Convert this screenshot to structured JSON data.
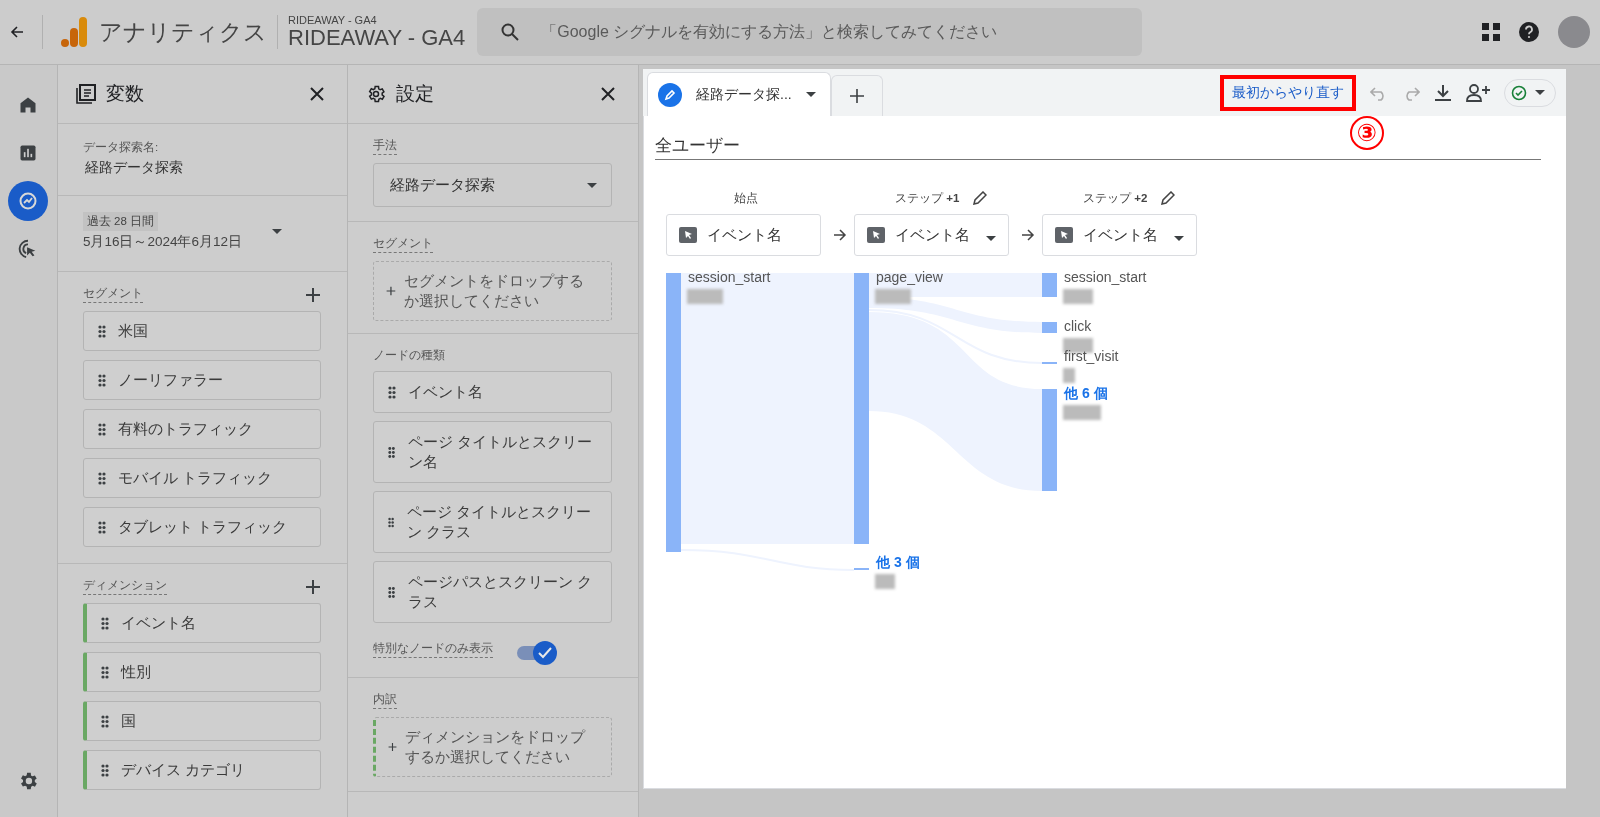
{
  "topbar": {
    "product": "アナリティクス",
    "account": "RIDEAWAY - GA4",
    "property": "RIDEAWAY - GA4",
    "search": {
      "placeholder": "「Google シグナルを有効にする方法」と検索してみてください"
    }
  },
  "nav": [
    {
      "kind": "home",
      "selected": false
    },
    {
      "kind": "reports",
      "selected": false
    },
    {
      "kind": "explore",
      "selected": true
    },
    {
      "kind": "advertising",
      "selected": false
    },
    {
      "kind": "admin",
      "selected": false
    }
  ],
  "variables": {
    "title": "変数",
    "name_label": "データ探索名:",
    "name": "経路データ探索",
    "date_badge": "過去 28 日間",
    "date_range": "5月16日～2024年6月12日",
    "segments": {
      "heading": "セグメント",
      "items": [
        "米国",
        "ノーリファラー",
        "有料のトラフィック",
        "モバイル トラフィック",
        "タブレット トラフィック"
      ]
    },
    "dimensions": {
      "heading": "ディメンション",
      "items": [
        "イベント名",
        "性別",
        "国",
        "デバイス カテゴリ"
      ]
    }
  },
  "settings": {
    "title": "設定",
    "technique": {
      "label": "手法",
      "value": "経路データ探索"
    },
    "segment": {
      "label": "セグメント",
      "placeholder": "セグメントをドロップするか選択してください"
    },
    "node_types": {
      "label": "ノードの種類",
      "items": [
        "イベント名",
        "ページ タイトルとスクリーン名",
        "ページ タイトルとスクリーン クラス",
        "ページパスとスクリーン クラス"
      ]
    },
    "toggle": {
      "label": "特別なノードのみ表示",
      "on": true
    },
    "breakdown": {
      "label": "内訳",
      "placeholder": "ディメンションをドロップするか選択してください"
    }
  },
  "canvas": {
    "tabs": [
      {
        "label": "経路データ探...",
        "selected": true
      }
    ],
    "reset_button": "最初からやり直す",
    "annotation": "③",
    "segment_title": "全ユーザー",
    "steps": [
      {
        "label": "始点",
        "editable": false,
        "selector": "イベント名",
        "dropdown": false
      },
      {
        "label": "ステップ **+1**",
        "editable": true,
        "selector": "イベント名",
        "dropdown": true
      },
      {
        "label": "ステップ **+2**",
        "editable": true,
        "selector": "イベント名",
        "dropdown": true
      }
    ],
    "columns": [
      [
        {
          "label": "session_start",
          "kind": "event"
        }
      ],
      [
        {
          "label": "page_view",
          "kind": "event"
        },
        {
          "label": "他 3 個",
          "kind": "other"
        }
      ],
      [
        {
          "label": "session_start",
          "kind": "event"
        },
        {
          "label": "click",
          "kind": "event"
        },
        {
          "label": "first_visit",
          "kind": "event"
        },
        {
          "label": "他 6 個",
          "kind": "other"
        }
      ]
    ]
  }
}
